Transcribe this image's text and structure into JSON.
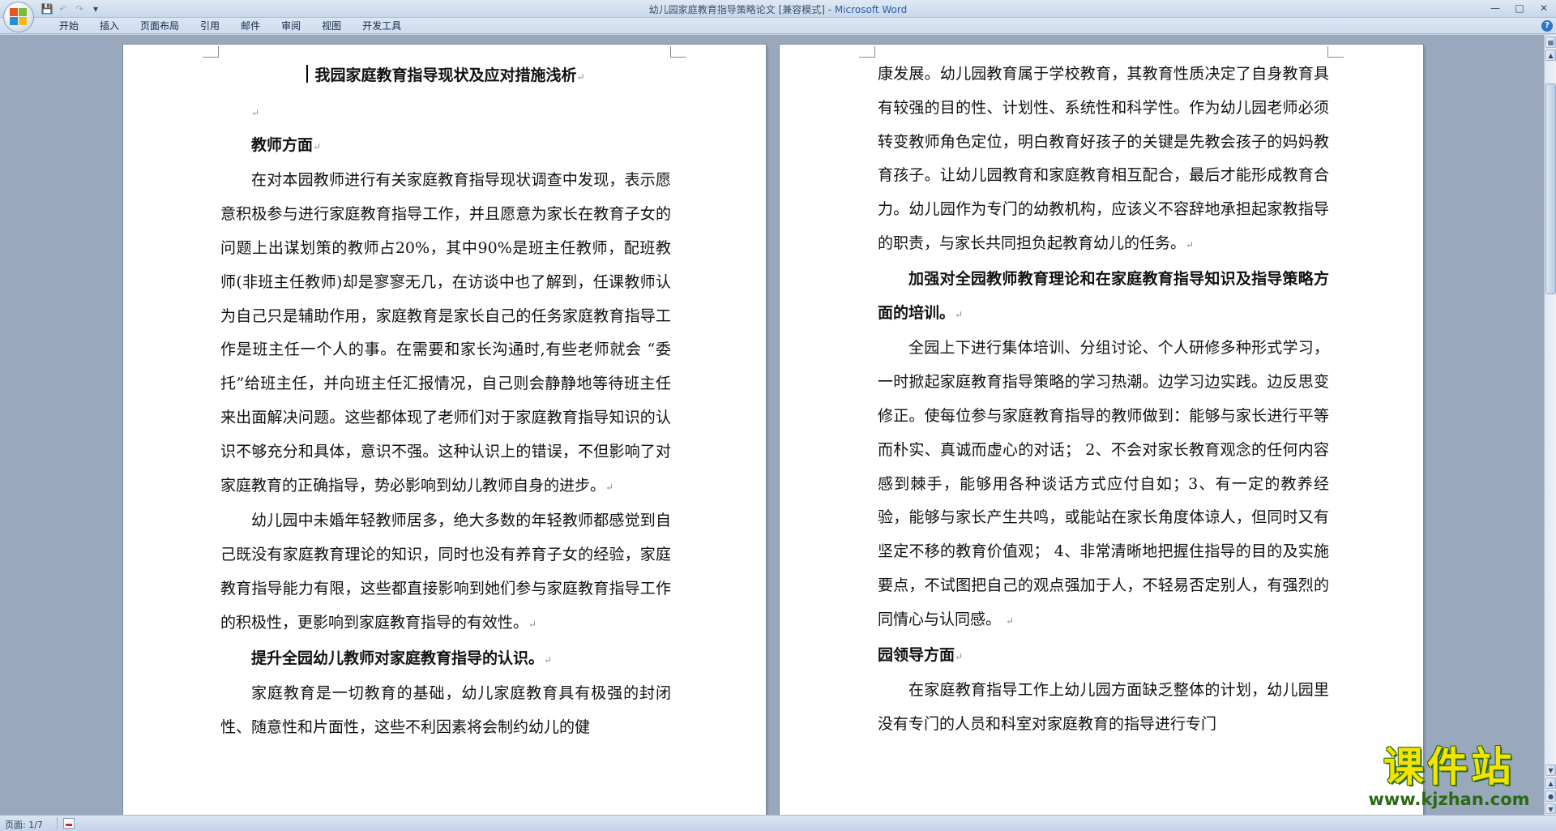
{
  "window": {
    "title_doc": "幼儿园家庭教育指导策略论文 [兼容模式] - ",
    "title_app": "Microsoft Word"
  },
  "quick_access": {
    "save_icon": "save-icon",
    "undo_icon": "undo-icon",
    "redo_icon": "redo-icon",
    "customize_icon": "dropdown-icon"
  },
  "ribbon": {
    "tabs": [
      "开始",
      "插入",
      "页面布局",
      "引用",
      "邮件",
      "审阅",
      "视图",
      "开发工具"
    ]
  },
  "left_page": {
    "title": "我园家庭教育指导现状及应对措施浅析",
    "heading1": "教师方面",
    "para1": "在对本园教师进行有关家庭教育指导现状调查中发现，表示愿意积极参与进行家庭教育指导工作，并且愿意为家长在教育子女的问题上出谋划策的教师占20%，其中90%是班主任教师，配班教师(非班主任教师)却是寥寥无几，在访谈中也了解到，任课教师认为自己只是辅助作用，家庭教育是家长自己的任务家庭教育指导工作是班主任一个人的事。在需要和家长沟通时,有些老师就会 “委托”给班主任，并向班主任汇报情况，自己则会静静地等待班主任来出面解决问题。这些都体现了老师们对于家庭教育指导知识的认识不够充分和具体，意识不强。这种认识上的错误，不但影响了对家庭教育的正确指导，势必影响到幼儿教师自身的进步。",
    "para2": "幼儿园中未婚年轻教师居多，绝大多数的年轻教师都感觉到自己既没有家庭教育理论的知识，同时也没有养育子女的经验，家庭教育指导能力有限，这些都直接影响到她们参与家庭教育指导工作的积极性，更影响到家庭教育指导的有效性。",
    "heading2": "提升全园幼儿教师对家庭教育指导的认识。",
    "para3": "家庭教育是一切教育的基础，幼儿家庭教育具有极强的封闭性、随意性和片面性，这些不利因素将会制约幼儿的健"
  },
  "right_page": {
    "para1": "康发展。幼儿园教育属于学校教育，其教育性质决定了自身教育具有较强的目的性、计划性、系统性和科学性。作为幼儿园老师必须转变教师角色定位，明白教育好孩子的关键是先教会孩子的妈妈教育孩子。让幼儿园教育和家庭教育相互配合，最后才能形成教育合力。幼儿园作为专门的幼教机构，应该义不容辞地承担起家教指导的职责，与家长共同担负起教育幼儿的任务。",
    "heading1": "加强对全园教师教育理论和在家庭教育指导知识及指导策略方面的培训。",
    "para2": "全园上下进行集体培训、分组讨论、个人研修多种形式学习，一时掀起家庭教育指导策略的学习热潮。边学习边实践。边反思变修正。使每位参与家庭教育指导的教师做到：能够与家长进行平等而朴实、真诚而虚心的对话； 2、不会对家长教育观念的任何内容感到棘手，能够用各种谈话方式应付自如；3、有一定的教养经验，能够与家长产生共鸣，或能站在家长角度体谅人，但同时又有坚定不移的教育价值观； 4、非常清晰地把握住指导的目的及实施要点，不试图把自己的观点强加于人，不轻易否定别人，有强烈的同情心与认同感。 ",
    "heading2": "园领导方面",
    "para3": "在家庭教育指导工作上幼儿园方面缺乏整体的计划，幼儿园里没有专门的人员和科室对家庭教育的指导进行专门"
  },
  "marks": {
    "paragraph": "↵"
  },
  "status": {
    "page": "页面: 1/7"
  },
  "watermark": {
    "title": "课件站",
    "url": "www.kjzhan.com"
  },
  "colors": {
    "accent": "#2d5ea8",
    "workspace": "#9aa8bd",
    "watermark_yellow": "#f2e400",
    "watermark_green": "#2a6a12"
  }
}
